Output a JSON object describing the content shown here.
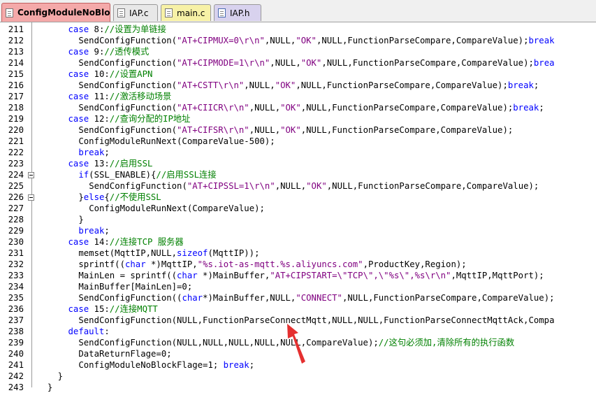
{
  "tabs": [
    {
      "label": "ConfigModuleNoBlock.c",
      "active": true
    },
    {
      "label": "IAP.c",
      "active": false
    },
    {
      "label": "main.c",
      "active": false
    },
    {
      "label": "IAP.h",
      "active": false
    }
  ],
  "colors": {
    "keyword": "#0000ff",
    "string": "#800080",
    "comment": "#008000",
    "active_tab": "#f4a9a9",
    "arrow": "#e53030"
  },
  "lines": [
    {
      "num": "211",
      "indent": 6,
      "fold": false,
      "segs": [
        [
          "kw",
          "case "
        ],
        [
          "",
          "8:"
        ],
        [
          "cm",
          "//设置为单链接"
        ]
      ]
    },
    {
      "num": "212",
      "indent": 8,
      "fold": false,
      "segs": [
        [
          "",
          "SendConfigFunction("
        ],
        [
          "str",
          "\"AT+CIPMUX=0\\r\\n\""
        ],
        [
          "",
          ",NULL,"
        ],
        [
          "str",
          "\"OK\""
        ],
        [
          "",
          ",NULL,FunctionParseCompare,CompareValue);"
        ],
        [
          "kw",
          "break"
        ]
      ]
    },
    {
      "num": "213",
      "indent": 6,
      "fold": false,
      "segs": [
        [
          "kw",
          "case "
        ],
        [
          "",
          "9:"
        ],
        [
          "cm",
          "//透传模式"
        ]
      ]
    },
    {
      "num": "214",
      "indent": 8,
      "fold": false,
      "segs": [
        [
          "",
          "SendConfigFunction("
        ],
        [
          "str",
          "\"AT+CIPMODE=1\\r\\n\""
        ],
        [
          "",
          ",NULL,"
        ],
        [
          "str",
          "\"OK\""
        ],
        [
          "",
          ",NULL,FunctionParseCompare,CompareValue);"
        ],
        [
          "kw",
          "brea"
        ]
      ]
    },
    {
      "num": "215",
      "indent": 6,
      "fold": false,
      "segs": [
        [
          "kw",
          "case "
        ],
        [
          "",
          "10:"
        ],
        [
          "cm",
          "//设置APN"
        ]
      ]
    },
    {
      "num": "216",
      "indent": 8,
      "fold": false,
      "segs": [
        [
          "",
          "SendConfigFunction("
        ],
        [
          "str",
          "\"AT+CSTT\\r\\n\""
        ],
        [
          "",
          ",NULL,"
        ],
        [
          "str",
          "\"OK\""
        ],
        [
          "",
          ",NULL,FunctionParseCompare,CompareValue);"
        ],
        [
          "kw",
          "break"
        ],
        [
          "",
          ";"
        ]
      ]
    },
    {
      "num": "217",
      "indent": 6,
      "fold": false,
      "segs": [
        [
          "kw",
          "case "
        ],
        [
          "",
          "11:"
        ],
        [
          "cm",
          "//激活移动场景"
        ]
      ]
    },
    {
      "num": "218",
      "indent": 8,
      "fold": false,
      "segs": [
        [
          "",
          "SendConfigFunction("
        ],
        [
          "str",
          "\"AT+CIICR\\r\\n\""
        ],
        [
          "",
          ",NULL,"
        ],
        [
          "str",
          "\"OK\""
        ],
        [
          "",
          ",NULL,FunctionParseCompare,CompareValue);"
        ],
        [
          "kw",
          "break"
        ],
        [
          "",
          ";"
        ]
      ]
    },
    {
      "num": "219",
      "indent": 6,
      "fold": false,
      "segs": [
        [
          "kw",
          "case "
        ],
        [
          "",
          "12:"
        ],
        [
          "cm",
          "//查询分配的IP地址"
        ]
      ]
    },
    {
      "num": "220",
      "indent": 8,
      "fold": false,
      "segs": [
        [
          "",
          "SendConfigFunction("
        ],
        [
          "str",
          "\"AT+CIFSR\\r\\n\""
        ],
        [
          "",
          ",NULL,"
        ],
        [
          "str",
          "\"OK\""
        ],
        [
          "",
          ",NULL,FunctionParseCompare,CompareValue);"
        ]
      ]
    },
    {
      "num": "221",
      "indent": 8,
      "fold": false,
      "segs": [
        [
          "",
          "ConfigModuleRunNext(CompareValue-500);"
        ]
      ]
    },
    {
      "num": "222",
      "indent": 8,
      "fold": false,
      "segs": [
        [
          "kw",
          "break"
        ],
        [
          "",
          ";"
        ]
      ]
    },
    {
      "num": "223",
      "indent": 6,
      "fold": false,
      "segs": [
        [
          "kw",
          "case "
        ],
        [
          "",
          "13:"
        ],
        [
          "cm",
          "//启用SSL"
        ]
      ]
    },
    {
      "num": "224",
      "indent": 8,
      "fold": true,
      "segs": [
        [
          "kw",
          "if"
        ],
        [
          "",
          "(SSL_ENABLE){"
        ],
        [
          "cm",
          "//启用SSL连接"
        ]
      ]
    },
    {
      "num": "225",
      "indent": 10,
      "fold": false,
      "segs": [
        [
          "",
          "SendConfigFunction("
        ],
        [
          "str",
          "\"AT+CIPSSL=1\\r\\n\""
        ],
        [
          "",
          ",NULL,"
        ],
        [
          "str",
          "\"OK\""
        ],
        [
          "",
          ",NULL,FunctionParseCompare,CompareValue);"
        ]
      ]
    },
    {
      "num": "226",
      "indent": 8,
      "fold": true,
      "segs": [
        [
          "",
          "}"
        ],
        [
          "kw",
          "else"
        ],
        [
          "",
          "{"
        ],
        [
          "cm",
          "//不使用SSL"
        ]
      ]
    },
    {
      "num": "227",
      "indent": 10,
      "fold": false,
      "segs": [
        [
          "",
          "ConfigModuleRunNext(CompareValue);"
        ]
      ]
    },
    {
      "num": "228",
      "indent": 8,
      "fold": false,
      "segs": [
        [
          "",
          "}"
        ]
      ]
    },
    {
      "num": "229",
      "indent": 8,
      "fold": false,
      "segs": [
        [
          "kw",
          "break"
        ],
        [
          "",
          ";"
        ]
      ]
    },
    {
      "num": "230",
      "indent": 6,
      "fold": false,
      "segs": [
        [
          "kw",
          "case "
        ],
        [
          "",
          "14:"
        ],
        [
          "cm",
          "//连接TCP 服务器"
        ]
      ]
    },
    {
      "num": "231",
      "indent": 8,
      "fold": false,
      "segs": [
        [
          "",
          "memset(MqttIP,NULL,"
        ],
        [
          "kw",
          "sizeof"
        ],
        [
          "",
          "(MqttIP));"
        ]
      ]
    },
    {
      "num": "232",
      "indent": 8,
      "fold": false,
      "segs": [
        [
          "",
          "sprintf(("
        ],
        [
          "kw",
          "char"
        ],
        [
          "",
          " *)MqttIP,"
        ],
        [
          "str",
          "\"%s.iot-as-mqtt.%s.aliyuncs.com\""
        ],
        [
          "",
          ",ProductKey,Region);"
        ]
      ]
    },
    {
      "num": "233",
      "indent": 8,
      "fold": false,
      "segs": [
        [
          "",
          "MainLen = sprintf(("
        ],
        [
          "kw",
          "char"
        ],
        [
          "",
          " *)MainBuffer,"
        ],
        [
          "str",
          "\"AT+CIPSTART=\\\"TCP\\\",\\\"%s\\\",%s\\r\\n\""
        ],
        [
          "",
          ",MqttIP,MqttPort);"
        ]
      ]
    },
    {
      "num": "234",
      "indent": 8,
      "fold": false,
      "segs": [
        [
          "",
          "MainBuffer[MainLen]=0;"
        ]
      ]
    },
    {
      "num": "235",
      "indent": 8,
      "fold": false,
      "segs": [
        [
          "",
          "SendConfigFunction(("
        ],
        [
          "kw",
          "char"
        ],
        [
          "",
          "*)MainBuffer,NULL,"
        ],
        [
          "str",
          "\"CONNECT\""
        ],
        [
          "",
          ",NULL,FunctionParseCompare,CompareValue);"
        ]
      ]
    },
    {
      "num": "236",
      "indent": 6,
      "fold": false,
      "segs": [
        [
          "kw",
          "case "
        ],
        [
          "",
          "15:"
        ],
        [
          "cm",
          "//连接MQTT"
        ]
      ]
    },
    {
      "num": "237",
      "indent": 8,
      "fold": false,
      "segs": [
        [
          "",
          "SendConfigFunction(NULL,FunctionParseConnectMqtt,NULL,NULL,FunctionParseConnectMqttAck,Compa"
        ]
      ]
    },
    {
      "num": "238",
      "indent": 6,
      "fold": false,
      "segs": [
        [
          "kw",
          "default"
        ],
        [
          "",
          ":"
        ]
      ]
    },
    {
      "num": "239",
      "indent": 8,
      "fold": false,
      "segs": [
        [
          "",
          "SendConfigFunction(NULL,NULL,NULL,NULL,NULL,CompareValue);"
        ],
        [
          "cm",
          "//这句必须加,清除所有的执行函数"
        ]
      ]
    },
    {
      "num": "240",
      "indent": 8,
      "fold": false,
      "segs": [
        [
          "",
          "DataReturnFlage=0;"
        ]
      ]
    },
    {
      "num": "241",
      "indent": 8,
      "fold": false,
      "segs": [
        [
          "",
          "ConfigModuleNoBlockFlage=1; "
        ],
        [
          "kw",
          "break"
        ],
        [
          "",
          ";"
        ]
      ]
    },
    {
      "num": "242",
      "indent": 4,
      "fold": false,
      "segs": [
        [
          "",
          "}"
        ]
      ]
    },
    {
      "num": "243",
      "indent": 2,
      "fold": false,
      "segs": [
        [
          "",
          "}"
        ]
      ]
    }
  ]
}
